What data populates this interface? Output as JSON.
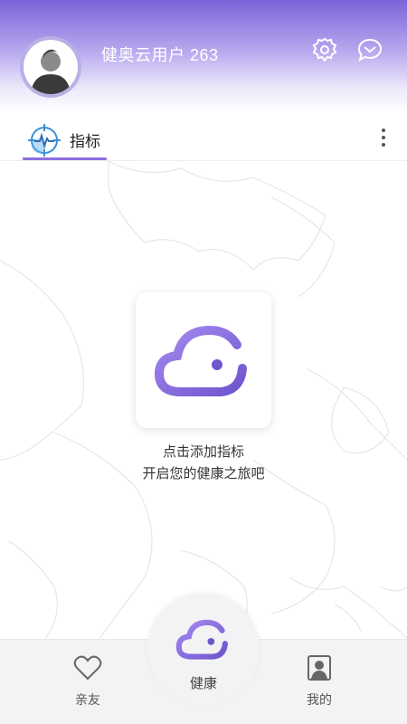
{
  "header": {
    "username": "健奥云用户 263",
    "settings_icon": "gear-icon",
    "message_icon": "message-icon"
  },
  "tabs": {
    "active_label": "指标",
    "active_icon": "radar-pulse-icon",
    "more_icon": "more-vertical-icon"
  },
  "empty_state": {
    "icon": "cloud-logo-icon",
    "line1": "点击添加指标",
    "line2": "开启您的健康之旅吧"
  },
  "bottom_nav": {
    "friends_label": "亲友",
    "health_label": "健康",
    "mine_label": "我的"
  },
  "colors": {
    "accent": "#8c6fe0",
    "header_start": "#7a64d8",
    "cloud_gradient_start": "#9b7ff0",
    "cloud_gradient_end": "#6f55cc"
  }
}
